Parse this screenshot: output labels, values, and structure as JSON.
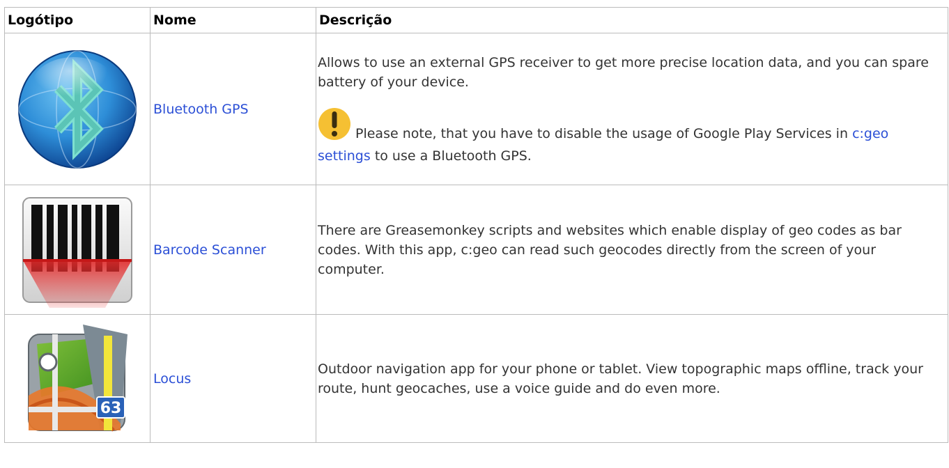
{
  "table": {
    "headers": [
      "Logótipo",
      "Nome",
      "Descrição"
    ],
    "rows": [
      {
        "logo_icon": "bluetooth-gps-logo",
        "name": "Bluetooth GPS",
        "desc_p1": "Allows to use an external GPS receiver to get more precise location data, and you can spare battery of your device.",
        "note_icon": "warning-icon",
        "note_before": "Please note, that you have to disable the usage of Google Play Services in ",
        "note_link": "c:geo settings",
        "note_after": " to use a Bluetooth GPS."
      },
      {
        "logo_icon": "barcode-scanner-logo",
        "name": "Barcode Scanner",
        "description": "There are Greasemonkey scripts and websites which enable display of geo codes as bar codes. With this app, c:geo can read such geocodes directly from the screen of your computer."
      },
      {
        "logo_icon": "locus-map-logo",
        "logo_badge": "63",
        "name": "Locus",
        "description": "Outdoor navigation app for your phone or tablet. View topographic maps offline, track your route, hunt geocaches, use a voice guide and do even more."
      }
    ]
  },
  "colors": {
    "link": "#2b4fd6",
    "border": "#bbbbbb",
    "text": "#333333",
    "warning": "#f5c033"
  }
}
